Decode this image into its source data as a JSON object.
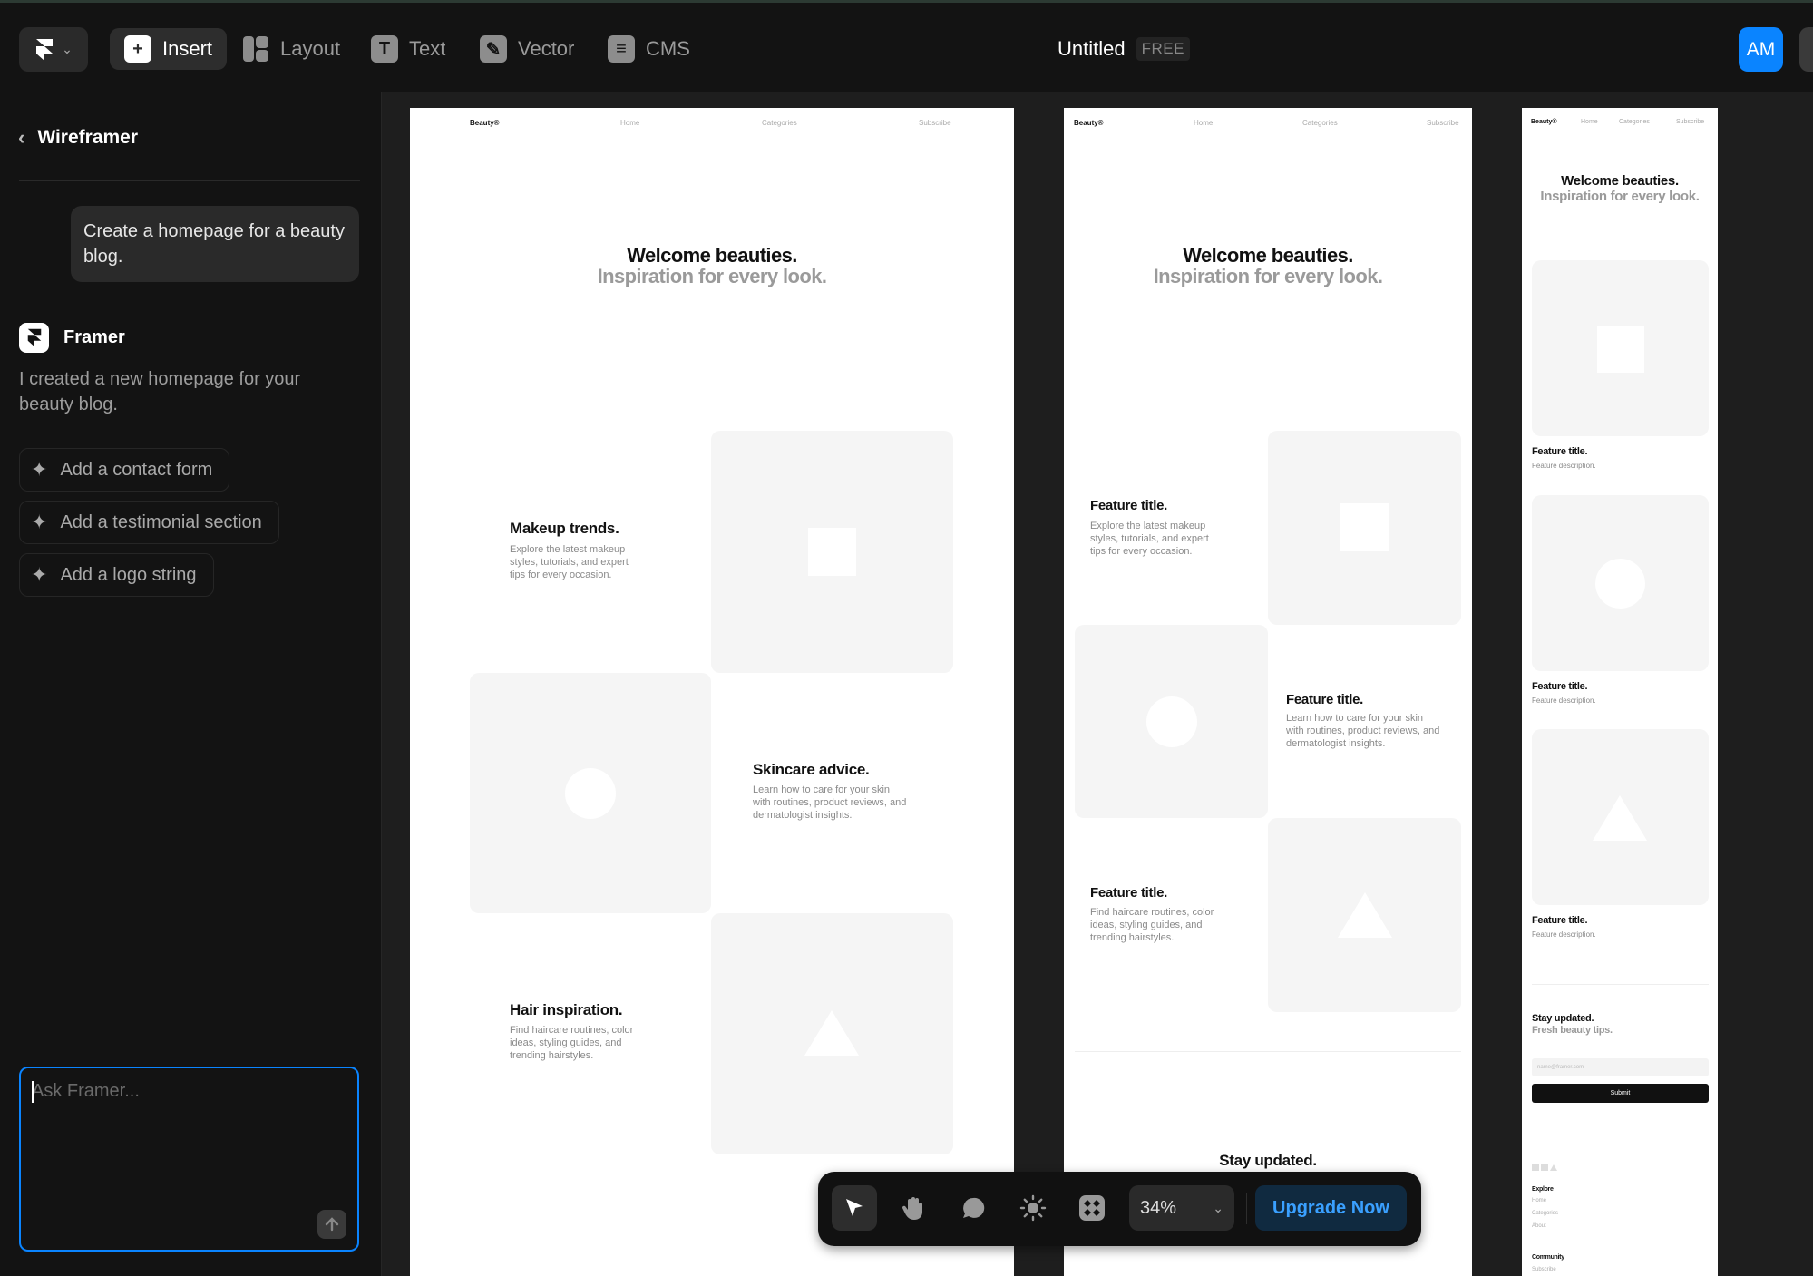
{
  "toolbar": {
    "insert": "Insert",
    "layout": "Layout",
    "text": "Text",
    "vector": "Vector",
    "cms": "CMS",
    "title": "Untitled",
    "plan_badge": "FREE",
    "avatar_initials": "AM"
  },
  "sidebar": {
    "back_title": "Wireframer",
    "user_message": "Create a homepage for a beauty blog.",
    "assistant_name": "Framer",
    "assistant_message": "I created a new homepage for your beauty blog.",
    "suggestions": [
      "Add a contact form",
      "Add a testimonial section",
      "Add a logo string"
    ],
    "prompt_placeholder": "Ask Framer..."
  },
  "canvas": {
    "nav": {
      "logo": "Beauty®",
      "home": "Home",
      "categories": "Categories",
      "subscribe": "Subscribe"
    },
    "hero": {
      "line1": "Welcome beauties.",
      "line2": "Inspiration for every look."
    },
    "desktop": {
      "features": [
        {
          "title": "Makeup trends.",
          "desc": "Explore the latest makeup styles, tutorials, and expert tips for every occasion."
        },
        {
          "title": "Skincare advice.",
          "desc": "Learn how to care for your skin with routines, product reviews, and dermatologist insights."
        },
        {
          "title": "Hair inspiration.",
          "desc": "Find haircare routines, color ideas, styling guides, and trending hairstyles."
        }
      ]
    },
    "tablet": {
      "features": [
        {
          "title": "Feature title.",
          "desc": "Explore the latest makeup styles, tutorials, and expert tips for every occasion."
        },
        {
          "title": "Feature title.",
          "desc": "Learn how to care for your skin with routines, product reviews, and dermatologist insights."
        },
        {
          "title": "Feature title.",
          "desc": "Find haircare routines, color ideas, styling guides, and trending hairstyles."
        }
      ],
      "stay_updated": "Stay updated."
    },
    "mobile": {
      "features": [
        {
          "title": "Feature title.",
          "desc": "Feature description."
        },
        {
          "title": "Feature title.",
          "desc": "Feature description."
        },
        {
          "title": "Feature title.",
          "desc": "Feature description."
        }
      ],
      "stay_title": "Stay updated.",
      "stay_sub": "Fresh beauty tips.",
      "email_placeholder": "name@framer.com",
      "submit": "Submit",
      "footer_explore": "Explore",
      "footer_links": [
        "Home",
        "Categories",
        "About"
      ],
      "footer_community": "Community",
      "footer_community_link": "Subscribe"
    }
  },
  "bottombar": {
    "zoom": "34%",
    "upgrade": "Upgrade Now"
  },
  "colors": {
    "accent": "#0a84ff",
    "background": "#131313"
  }
}
